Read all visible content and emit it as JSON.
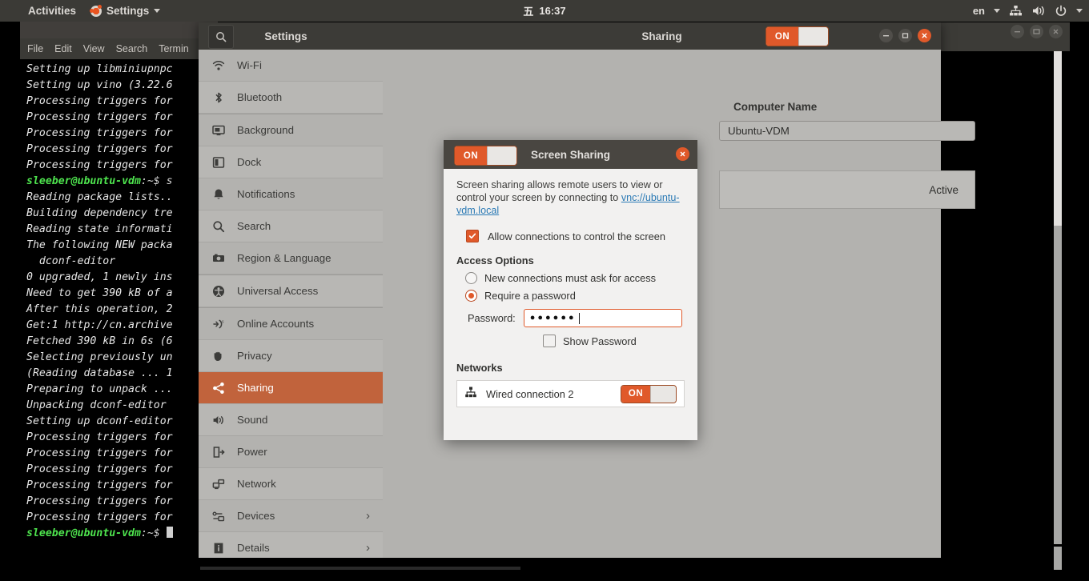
{
  "topbar": {
    "activities": "Activities",
    "app_name": "Settings",
    "app_icon": "ubuntu-logo-icon",
    "clock_day": "五",
    "clock_time": "16:37",
    "lang": "en",
    "icons": [
      "network-icon",
      "volume-icon",
      "power-icon"
    ]
  },
  "terminal": {
    "menus": [
      "File",
      "Edit",
      "View",
      "Search",
      "Termin"
    ],
    "lines": [
      {
        "text": "Setting up libminiupnpc",
        "type": "out"
      },
      {
        "text": "Setting up vino (3.22.6",
        "type": "out"
      },
      {
        "text": "Processing triggers for",
        "type": "out"
      },
      {
        "text": "Processing triggers for",
        "type": "out"
      },
      {
        "text": "Processing triggers for",
        "type": "out"
      },
      {
        "text": "Processing triggers for",
        "type": "out"
      },
      {
        "text": "Processing triggers for",
        "type": "out"
      },
      {
        "user": "sleeber@ubuntu-vdm",
        "path": ":~$ s",
        "type": "prompt"
      },
      {
        "text": "Reading package lists..",
        "type": "out"
      },
      {
        "text": "Building dependency tre",
        "type": "out"
      },
      {
        "text": "Reading state informati",
        "type": "out"
      },
      {
        "text": "The following NEW packa",
        "type": "out"
      },
      {
        "text": "  dconf-editor",
        "type": "out"
      },
      {
        "text": "0 upgraded, 1 newly ins",
        "type": "out"
      },
      {
        "text": "Need to get 390 kB of a",
        "type": "out"
      },
      {
        "text": "After this operation, 2",
        "type": "out"
      },
      {
        "text": "Get:1 http://cn.archive",
        "type": "out"
      },
      {
        "text": "Fetched 390 kB in 6s (6",
        "type": "out"
      },
      {
        "text": "Selecting previously un",
        "type": "out"
      },
      {
        "text": "(Reading database ... 1",
        "type": "out"
      },
      {
        "text": "Preparing to unpack ...",
        "type": "out"
      },
      {
        "text": "Unpacking dconf-editor",
        "type": "out"
      },
      {
        "text": "Setting up dconf-editor",
        "type": "out"
      },
      {
        "text": "Processing triggers for",
        "type": "out"
      },
      {
        "text": "Processing triggers for",
        "type": "out"
      },
      {
        "text": "Processing triggers for",
        "type": "out"
      },
      {
        "text": "Processing triggers for",
        "type": "out"
      },
      {
        "text": "Processing triggers for",
        "type": "out"
      },
      {
        "text": "Processing triggers for",
        "type": "out"
      },
      {
        "user": "sleeber@ubuntu-vdm",
        "path": ":~$ ",
        "type": "prompt-cursor"
      }
    ]
  },
  "settings": {
    "sidebar_title": "Settings",
    "search_icon": "search-icon",
    "page_title": "Sharing",
    "header_toggle": "ON",
    "items": [
      {
        "label": "Wi-Fi",
        "icon": "wifi-icon",
        "selected": false,
        "chevron": false
      },
      {
        "label": "Bluetooth",
        "icon": "bluetooth-icon",
        "selected": false,
        "chevron": false
      },
      {
        "label": "Background",
        "icon": "background-icon",
        "selected": false,
        "chevron": false
      },
      {
        "label": "Dock",
        "icon": "dock-icon",
        "selected": false,
        "chevron": false
      },
      {
        "label": "Notifications",
        "icon": "bell-icon",
        "selected": false,
        "chevron": false
      },
      {
        "label": "Search",
        "icon": "search-icon",
        "selected": false,
        "chevron": false
      },
      {
        "label": "Region & Language",
        "icon": "region-icon",
        "selected": false,
        "chevron": false
      },
      {
        "label": "Universal Access",
        "icon": "accessibility-icon",
        "selected": false,
        "chevron": false
      },
      {
        "label": "Online Accounts",
        "icon": "online-accounts-icon",
        "selected": false,
        "chevron": false
      },
      {
        "label": "Privacy",
        "icon": "hand-icon",
        "selected": false,
        "chevron": false
      },
      {
        "label": "Sharing",
        "icon": "share-icon",
        "selected": true,
        "chevron": false
      },
      {
        "label": "Sound",
        "icon": "speaker-icon",
        "selected": false,
        "chevron": false
      },
      {
        "label": "Power",
        "icon": "power-plug-icon",
        "selected": false,
        "chevron": false
      },
      {
        "label": "Network",
        "icon": "network-icon",
        "selected": false,
        "chevron": false
      },
      {
        "label": "Devices",
        "icon": "devices-icon",
        "selected": false,
        "chevron": true
      },
      {
        "label": "Details",
        "icon": "info-icon",
        "selected": false,
        "chevron": true
      }
    ],
    "main": {
      "computer_name_label": "Computer Name",
      "computer_name_value": "Ubuntu-VDM",
      "row_status": "Active"
    }
  },
  "dialog": {
    "title": "Screen Sharing",
    "toggle": "ON",
    "close_icon": "close-icon",
    "description_pre": "Screen sharing allows remote users to view or control your screen by connecting to ",
    "link_text": "vnc://ubuntu-vdm.local",
    "allow_control_label": "Allow connections to control the screen",
    "allow_control_checked": true,
    "access_options_title": "Access Options",
    "radio_ask_label": "New connections must ask for access",
    "radio_ask_selected": false,
    "radio_password_label": "Require a password",
    "radio_password_selected": true,
    "password_label": "Password:",
    "password_value": "●●●●●●",
    "show_password_label": "Show Password",
    "show_password_checked": false,
    "networks_title": "Networks",
    "network_name": "Wired connection 2",
    "network_icon": "wired-network-icon",
    "network_toggle": "ON"
  },
  "colors": {
    "accent_orange": "#e0592a",
    "selection_orange": "#c1633c",
    "panel_gray": "#b3b2af",
    "titlebar_dark": "#3c3b37",
    "dialog_bg": "#f2f1f0",
    "link_blue": "#2b7ab5",
    "terminal_green": "#4ee44e"
  }
}
